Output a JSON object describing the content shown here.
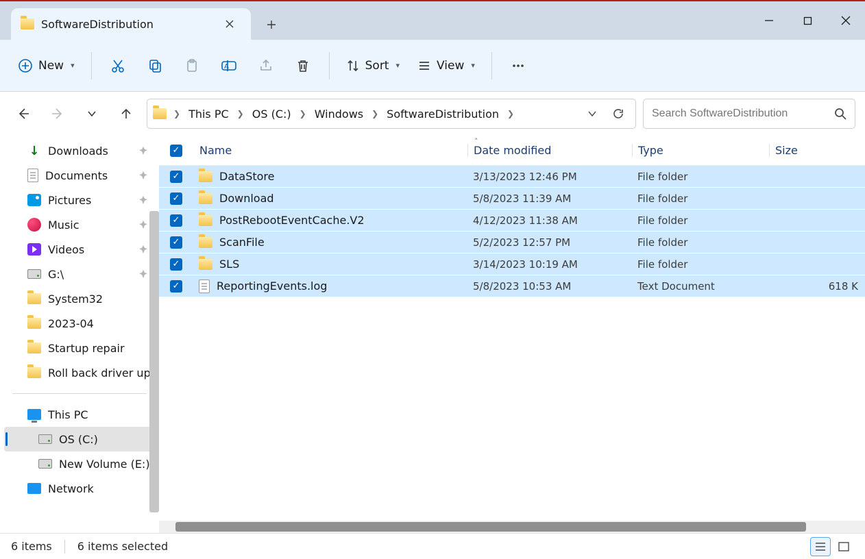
{
  "window": {
    "tab_title": "SoftwareDistribution"
  },
  "ribbon": {
    "new_label": "New",
    "sort_label": "Sort",
    "view_label": "View"
  },
  "breadcrumb": {
    "parts": [
      "This PC",
      "OS (C:)",
      "Windows",
      "SoftwareDistribution"
    ]
  },
  "search": {
    "placeholder": "Search SoftwareDistribution"
  },
  "sidebar": {
    "quick": [
      {
        "label": "Downloads",
        "icon": "download",
        "pinned": true
      },
      {
        "label": "Documents",
        "icon": "doc",
        "pinned": true
      },
      {
        "label": "Pictures",
        "icon": "img",
        "pinned": true
      },
      {
        "label": "Music",
        "icon": "music",
        "pinned": true
      },
      {
        "label": "Videos",
        "icon": "vid",
        "pinned": true
      },
      {
        "label": "G:\\",
        "icon": "drive",
        "pinned": true
      },
      {
        "label": "System32",
        "icon": "folder",
        "pinned": false
      },
      {
        "label": "2023-04",
        "icon": "folder",
        "pinned": false
      },
      {
        "label": "Startup repair",
        "icon": "folder",
        "pinned": false
      },
      {
        "label": "Roll back driver up",
        "icon": "folder",
        "pinned": false
      }
    ],
    "tree": [
      {
        "label": "This PC",
        "icon": "pc",
        "depth": 1,
        "selected": false
      },
      {
        "label": "OS (C:)",
        "icon": "drive",
        "depth": 2,
        "selected": true
      },
      {
        "label": "New Volume (E:)",
        "icon": "drive",
        "depth": 2,
        "selected": false
      },
      {
        "label": "Network",
        "icon": "net",
        "depth": 1,
        "selected": false
      }
    ]
  },
  "columns": {
    "name": "Name",
    "date": "Date modified",
    "type": "Type",
    "size": "Size"
  },
  "files": [
    {
      "name": "DataStore",
      "date": "3/13/2023 12:46 PM",
      "type": "File folder",
      "size": "",
      "icon": "folder"
    },
    {
      "name": "Download",
      "date": "5/8/2023 11:39 AM",
      "type": "File folder",
      "size": "",
      "icon": "folder"
    },
    {
      "name": "PostRebootEventCache.V2",
      "date": "4/12/2023 11:38 AM",
      "type": "File folder",
      "size": "",
      "icon": "folder"
    },
    {
      "name": "ScanFile",
      "date": "5/2/2023 12:57 PM",
      "type": "File folder",
      "size": "",
      "icon": "folder"
    },
    {
      "name": "SLS",
      "date": "3/14/2023 10:19 AM",
      "type": "File folder",
      "size": "",
      "icon": "folder"
    },
    {
      "name": "ReportingEvents.log",
      "date": "5/8/2023 10:53 AM",
      "type": "Text Document",
      "size": "618 K",
      "icon": "doc"
    }
  ],
  "status": {
    "count": "6 items",
    "selected": "6 items selected"
  }
}
